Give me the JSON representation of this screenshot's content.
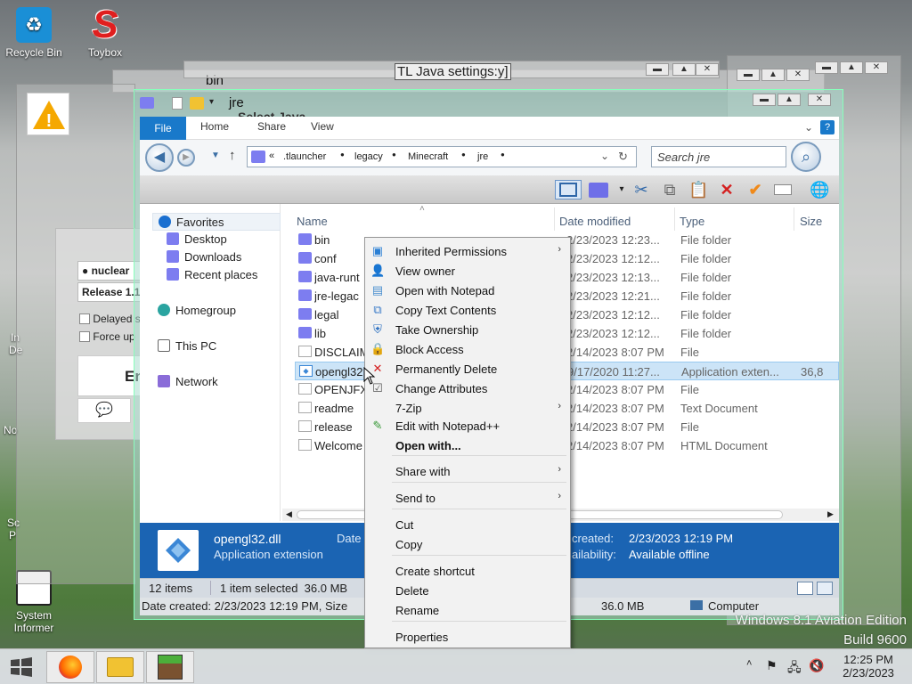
{
  "desktop": {
    "icons": [
      {
        "label": "Recycle Bin",
        "icon": "recycle-bin-icon"
      },
      {
        "label": "Toybox",
        "icon": "toybox-icon"
      },
      {
        "label": "System Informer",
        "icon": "system-informer-icon"
      }
    ],
    "partial_labels": [
      "In",
      "De",
      "No",
      "Sc",
      "P"
    ],
    "watermark": {
      "line1": "Windows 8.1 Aviation Edition",
      "line2": "Build 9600"
    }
  },
  "background_windows": {
    "bin_title": "bin",
    "java_settings_title": "TL Java settings:y]",
    "select_java_title": "Select Java",
    "tlauncher": {
      "account": "nuclear",
      "version": "Release 1.1",
      "option1": "Delayed s",
      "option2": "Force up",
      "enter_button": "En",
      "warning_icon": "warning-icon"
    }
  },
  "explorer": {
    "title": "jre",
    "ribbon_tabs": [
      "File",
      "Home",
      "Share",
      "View"
    ],
    "breadcrumb": [
      ".tlauncher",
      "legacy",
      "Minecraft",
      "jre"
    ],
    "breadcrumb_prefix": "«",
    "search_placeholder": "Search jre",
    "nav": {
      "favorites": "Favorites",
      "desktop": "Desktop",
      "downloads": "Downloads",
      "recent": "Recent places",
      "homegroup": "Homegroup",
      "this_pc": "This PC",
      "network": "Network"
    },
    "columns": {
      "name": "Name",
      "date": "Date modified",
      "type": "Type",
      "size": "Size"
    },
    "files": [
      {
        "name": "bin",
        "date": "2/23/2023 12:23...",
        "type": "File folder",
        "size": "",
        "kind": "folder"
      },
      {
        "name": "conf",
        "date": "2/23/2023 12:12...",
        "type": "File folder",
        "size": "",
        "kind": "folder"
      },
      {
        "name": "java-runt",
        "date": "2/23/2023 12:13...",
        "type": "File folder",
        "size": "",
        "kind": "folder"
      },
      {
        "name": "jre-legac",
        "date": "2/23/2023 12:21...",
        "type": "File folder",
        "size": "",
        "kind": "folder"
      },
      {
        "name": "legal",
        "date": "2/23/2023 12:12...",
        "type": "File folder",
        "size": "",
        "kind": "folder"
      },
      {
        "name": "lib",
        "date": "2/23/2023 12:12...",
        "type": "File folder",
        "size": "",
        "kind": "folder"
      },
      {
        "name": "DISCLAIM",
        "date": "2/14/2023 8:07 PM",
        "type": "File",
        "size": "",
        "kind": "file"
      },
      {
        "name": "opengl32",
        "date": "9/17/2020 11:27...",
        "type": "Application exten...",
        "size": "36,8",
        "kind": "dll"
      },
      {
        "name": "OPENJFX",
        "date": "2/14/2023 8:07 PM",
        "type": "File",
        "size": "",
        "kind": "file"
      },
      {
        "name": "readme",
        "date": "2/14/2023 8:07 PM",
        "type": "Text Document",
        "size": "",
        "kind": "file"
      },
      {
        "name": "release",
        "date": "2/14/2023 8:07 PM",
        "type": "File",
        "size": "",
        "kind": "file"
      },
      {
        "name": "Welcome",
        "date": "2/14/2023 8:07 PM",
        "type": "HTML Document",
        "size": "",
        "kind": "file"
      }
    ],
    "details": {
      "filename": "opengl32.dll",
      "filetype": "Application extension",
      "date_label": "Date",
      "created_label": "created:",
      "created_value": "2/23/2023 12:19 PM",
      "availability_label": "ailability:",
      "availability_value": "Available offline"
    },
    "status": {
      "items": "12 items",
      "selected": "1 item selected  36.0 MB"
    },
    "infobar": {
      "left": "Date created: 2/23/2023 12:19 PM, Size",
      "size": "36.0 MB",
      "location": "Computer"
    }
  },
  "context_menu": {
    "items": [
      {
        "label": "Inherited Permissions",
        "icon": "permissions-icon",
        "submenu": true
      },
      {
        "label": "View owner",
        "icon": "owner-icon",
        "submenu": false
      },
      {
        "label": "Open with Notepad",
        "icon": "notepad-icon",
        "submenu": false
      },
      {
        "label": "Copy Text Contents",
        "icon": "copy-text-icon",
        "submenu": false
      },
      {
        "label": "Take Ownership",
        "icon": "shield-icon",
        "submenu": false
      },
      {
        "label": "Block Access",
        "icon": "lock-icon",
        "submenu": false
      },
      {
        "label": "Permanently Delete",
        "icon": "delete-x-icon",
        "submenu": false
      },
      {
        "label": "Change Attributes",
        "icon": "attributes-icon",
        "submenu": false
      },
      {
        "label": "7-Zip",
        "icon": "",
        "submenu": true
      },
      {
        "label": "Edit with Notepad++",
        "icon": "notepadpp-icon",
        "submenu": false
      },
      {
        "label": "Open with...",
        "icon": "",
        "submenu": false
      },
      {
        "label": "Share with",
        "icon": "",
        "submenu": true
      },
      {
        "label": "Send to",
        "icon": "",
        "submenu": true
      },
      {
        "label": "Cut",
        "icon": "",
        "submenu": false
      },
      {
        "label": "Copy",
        "icon": "",
        "submenu": false
      },
      {
        "label": "Create shortcut",
        "icon": "",
        "submenu": false
      },
      {
        "label": "Delete",
        "icon": "",
        "submenu": false
      },
      {
        "label": "Rename",
        "icon": "",
        "submenu": false
      },
      {
        "label": "Properties",
        "icon": "",
        "submenu": false
      }
    ]
  },
  "taskbar": {
    "apps": [
      "firefox-icon",
      "file-explorer-icon",
      "minecraft-icon"
    ],
    "time": "12:25 PM",
    "date": "2/23/2023"
  }
}
